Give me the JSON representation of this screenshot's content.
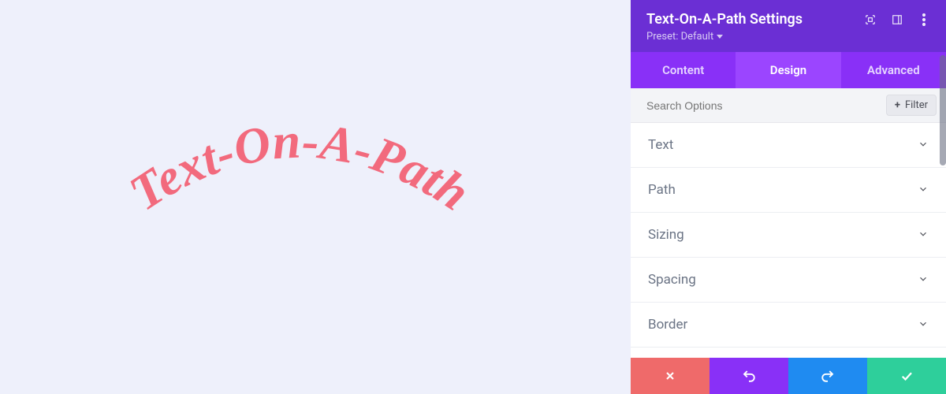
{
  "canvas": {
    "text": "Text-On-A-Path",
    "text_color": "#f26a7d"
  },
  "panel": {
    "title": "Text-On-A-Path Settings",
    "preset_label": "Preset: Default",
    "tabs": [
      {
        "label": "Content",
        "active": false
      },
      {
        "label": "Design",
        "active": true
      },
      {
        "label": "Advanced",
        "active": false
      }
    ],
    "search_placeholder": "Search Options",
    "filter_label": "Filter",
    "sections": [
      {
        "label": "Text"
      },
      {
        "label": "Path"
      },
      {
        "label": "Sizing"
      },
      {
        "label": "Spacing"
      },
      {
        "label": "Border"
      }
    ],
    "header_icons": [
      "expand-icon",
      "layout-icon",
      "more-icon"
    ],
    "action_icons": [
      "close-icon",
      "undo-icon",
      "redo-icon",
      "check-icon"
    ]
  },
  "colors": {
    "header": "#6b2fd4",
    "tabbar": "#8930f7",
    "tab_active": "#9b45ff",
    "cancel": "#ef6a6a",
    "undo": "#8930f7",
    "redo": "#1f8bf1",
    "save": "#2ecf9b"
  }
}
